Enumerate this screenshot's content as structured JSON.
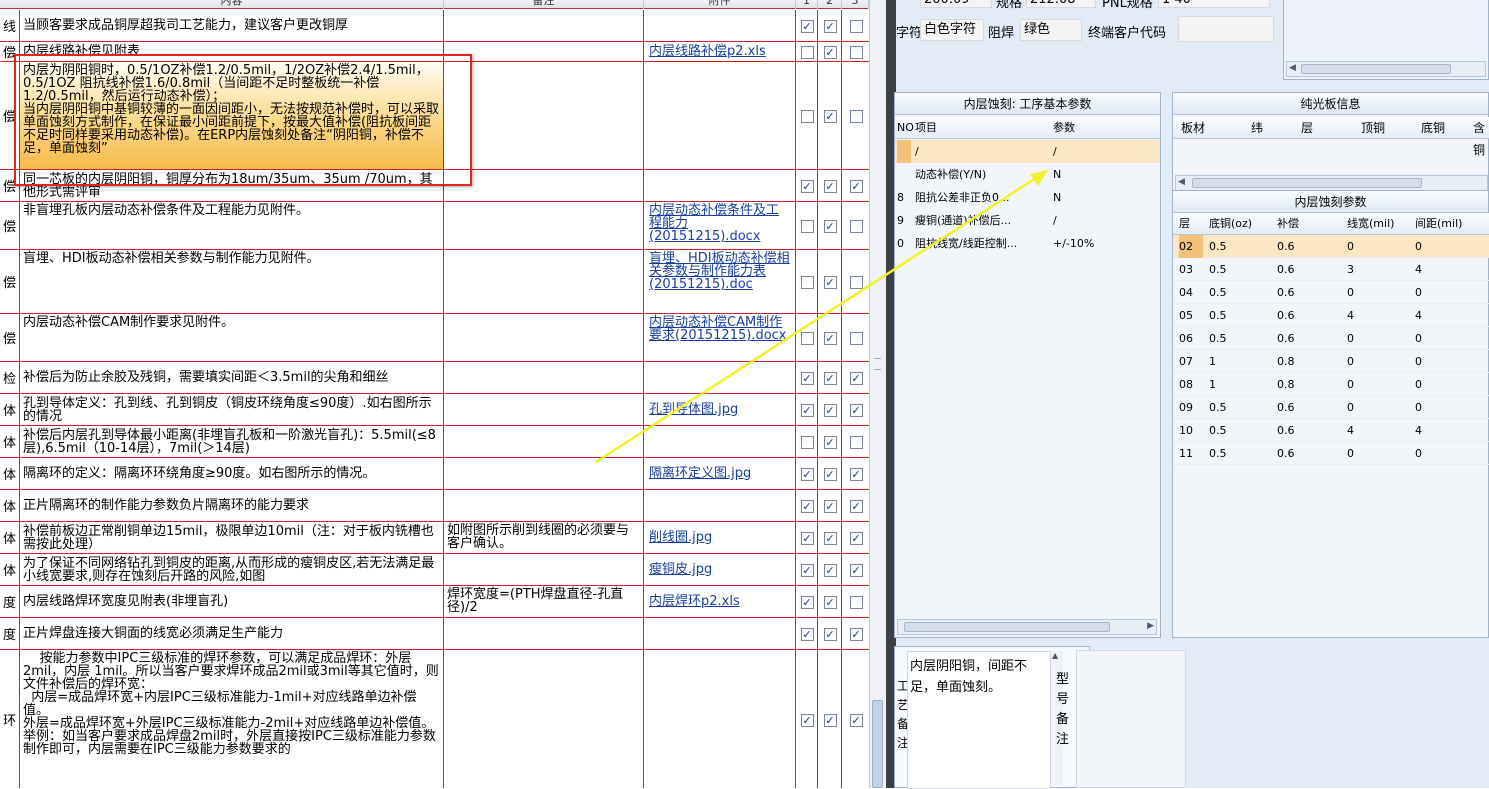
{
  "left_table": {
    "headers": [
      "内容",
      "备注",
      "附件",
      "1",
      "2",
      "3"
    ],
    "rows": [
      {
        "cat": "线",
        "content": "当顾客要求成品铜厚超我司工艺能力，建议客户更改铜厚",
        "note": "",
        "attach": "",
        "checks": [
          true,
          true,
          false
        ]
      },
      {
        "cat": "偿",
        "content": "内层线路补偿见附表",
        "note": "",
        "attach": "内层线路补偿p2.xls",
        "checks": [
          false,
          true,
          false
        ]
      },
      {
        "cat": "偿",
        "content": "内层为阴阳铜时，0.5/1OZ补偿1.2/0.5mil，1/2OZ补偿2.4/1.5mil，0.5/1OZ 阻抗线补偿1.6/0.8mil（当间距不足时整板统一补偿1.2/0.5mil，然后运行动态补偿）；\n当内层阴阳铜中基铜较薄的一面因间距小，无法按规范补偿时，可以采取单面蚀刻方式制作，在保证最小间距前提下，按最大值补偿(阻抗板间距不足时同样要采用动态补偿)。在ERP内层蚀刻处备注“阴阳铜，补偿不足，单面蚀刻”",
        "note": "",
        "attach": "",
        "checks": [
          false,
          true,
          false
        ]
      },
      {
        "cat": "偿",
        "content": "同一芯板的内层阴阳铜，铜厚分布为18um/35um、35um /70um，其他形式需评审",
        "note": "",
        "attach": "",
        "checks": [
          true,
          true,
          true
        ]
      },
      {
        "cat": "偿",
        "content": "非盲埋孔板内层动态补偿条件及工程能力见附件。",
        "note": "",
        "attach": "内层动态补偿条件及工程能力(20151215).docx",
        "checks": [
          false,
          true,
          false
        ]
      },
      {
        "cat": "偿",
        "content": "盲埋、HDI板动态补偿相关参数与制作能力见附件。",
        "note": "",
        "attach": "盲埋、HDI板动态补偿相关参数与制作能力表(20151215).doc",
        "checks": [
          false,
          true,
          false
        ]
      },
      {
        "cat": "偿",
        "content": "内层动态补偿CAM制作要求见附件。",
        "note": "",
        "attach": "内层动态补偿CAM制作要求(20151215).docx",
        "checks": [
          false,
          true,
          false
        ]
      },
      {
        "cat": "检",
        "content": "补偿后为防止余胶及残铜，需要填实间距＜3.5mil的尖角和细丝",
        "note": "",
        "attach": "",
        "checks": [
          true,
          true,
          true
        ]
      },
      {
        "cat": "体",
        "content": "孔到导体定义：孔到线、孔到铜皮（铜皮环绕角度≤90度）.如右图所示的情况",
        "note": "",
        "attach": "孔到导体图.jpg",
        "checks": [
          true,
          true,
          true
        ]
      },
      {
        "cat": "体",
        "content": "补偿后内层孔到导体最小距离(非埋盲孔板和一阶激光盲孔)：5.5mil(≤8层),6.5mil（10-14层），7mil(＞14层)",
        "note": "",
        "attach": "",
        "checks": [
          false,
          true,
          false
        ]
      },
      {
        "cat": "体",
        "content": "隔离环的定义：隔离环环绕角度≥90度。如右图所示的情况。",
        "note": "",
        "attach": "隔离环定义图.jpg",
        "checks": [
          true,
          true,
          true
        ]
      },
      {
        "cat": "体",
        "content": "正片隔离环的制作能力参数负片隔离环的能力要求",
        "note": "",
        "attach": "",
        "checks": [
          true,
          true,
          true
        ]
      },
      {
        "cat": "体",
        "content": "补偿前板边正常削铜单边15mil，极限单边10mil（注：对于板内铣槽也需按此处理）",
        "note": "如附图所示削到线圈的必须要与客户确认。",
        "attach": "削线圈.jpg",
        "checks": [
          true,
          true,
          true
        ]
      },
      {
        "cat": "体",
        "content": "为了保证不同网络钻孔到铜皮的距离,从而形成的瘦铜皮区,若无法满足最小线宽要求,则存在蚀刻后开路的风险,如图",
        "note": "",
        "attach": "瘦铜皮.jpg",
        "checks": [
          true,
          true,
          true
        ]
      },
      {
        "cat": "度",
        "content": "内层线路焊环宽度见附表(非埋盲孔)",
        "note": "焊环宽度=(PTH焊盘直径-孔直径)/2",
        "attach": "内层焊环p2.xls",
        "checks": [
          true,
          true,
          false
        ]
      },
      {
        "cat": "度",
        "content": "正片焊盘连接大铜面的线宽必须满足生产能力",
        "note": "",
        "attach": "",
        "checks": [
          true,
          true,
          true
        ]
      },
      {
        "cat": "环",
        "content": "    按能力参数中IPC三级标准的焊环参数，可以满足成品焊环：外层2mil，内层 1mil。所以当客户要求焊环成品2mil或3mil等其它值时，则文件补偿后的焊环宽：\n  内层=成品焊环宽+内层IPC三级标准能力-1mil+对应线路单边补偿值。\n外层=成品焊环宽+外层IPC三级标准能力-2mil+对应线路单边补偿值。\n举例：如当客户要求成品焊盘2mil时，外层直接按IPC三级标准能力参数制作即可，内层需要在IPC三级能力参数要求的",
        "note": "",
        "attach": "",
        "checks": [
          true,
          true,
          true
        ]
      }
    ]
  },
  "top_form": {
    "val1": "200.09",
    "label_gui_ge": "规格",
    "val2": "212.08",
    "label_pnl": "PNL规格",
    "val3": "1  40",
    "label_zifu": "字符",
    "zifu_value": "白色字符",
    "label_zuhan": "阻焊",
    "zuhan_value": "绿色",
    "label_terminal": "终端客户代码",
    "terminal_value": ""
  },
  "etch_panel": {
    "title": "内层蚀刻: 工序基本参数",
    "col_no": "NO",
    "col_item": "项目",
    "col_param": "参数",
    "rows": [
      {
        "no": "",
        "item": "/",
        "param": "/"
      },
      {
        "no": "",
        "item": "动态补偿(Y/N)",
        "param": "N"
      },
      {
        "no": "8",
        "item": "阻抗公差非正负0...",
        "param": "N"
      },
      {
        "no": "9",
        "item": "瘦铜(通道)补偿后...",
        "param": "/"
      },
      {
        "no": "0",
        "item": "阻抗线宽/线距控制...",
        "param": "+/-10%"
      }
    ]
  },
  "bare_panel": {
    "title": "纯光板信息",
    "headers": [
      "板材",
      "纬",
      "层",
      "顶铜",
      "底铜",
      "含铜"
    ]
  },
  "layer_panel": {
    "title": "内层蚀刻参数",
    "headers": [
      "层",
      "底铜(oz)",
      "补偿",
      "线宽(mil)",
      "间距(mil)"
    ],
    "rows": [
      [
        "02",
        "0.5",
        "0.6",
        "0",
        "0"
      ],
      [
        "03",
        "0.5",
        "0.6",
        "3",
        "4"
      ],
      [
        "04",
        "0.5",
        "0.6",
        "0",
        "0"
      ],
      [
        "05",
        "0.5",
        "0.6",
        "4",
        "4"
      ],
      [
        "06",
        "0.5",
        "0.6",
        "0",
        "0"
      ],
      [
        "07",
        "1",
        "0.8",
        "0",
        "0"
      ],
      [
        "08",
        "1",
        "0.8",
        "0",
        "0"
      ],
      [
        "09",
        "0.5",
        "0.6",
        "0",
        "0"
      ],
      [
        "10",
        "0.5",
        "0.6",
        "4",
        "4"
      ],
      [
        "11",
        "0.5",
        "0.6",
        "0",
        "0"
      ]
    ]
  },
  "notes": {
    "side_label": "工艺备注",
    "text": "内层阴阳铜，间距不足，单面蚀刻。",
    "model_label": "型号备注"
  },
  "colors": {
    "highlight_box": "#e0261f",
    "arrow": "#f2f22a",
    "row_line": "#c42626"
  }
}
